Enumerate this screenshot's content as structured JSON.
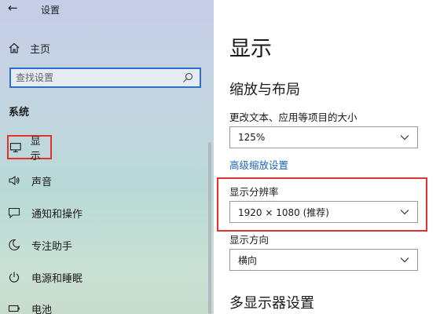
{
  "app": {
    "title": "设置"
  },
  "sidebar": {
    "home_label": "主页",
    "search_placeholder": "查找设置",
    "section_label": "系统",
    "items": [
      {
        "label": "显示",
        "icon": "monitor-icon",
        "active": true
      },
      {
        "label": "声音",
        "icon": "speaker-icon"
      },
      {
        "label": "通知和操作",
        "icon": "notification-icon"
      },
      {
        "label": "专注助手",
        "icon": "moon-icon"
      },
      {
        "label": "电源和睡眠",
        "icon": "power-icon"
      },
      {
        "label": "电池",
        "icon": "battery-icon"
      }
    ]
  },
  "main": {
    "title": "显示",
    "scale_section": {
      "heading": "缩放与布局",
      "text_size_label": "更改文本、应用等项目的大小",
      "text_size_value": "125%",
      "advanced_link": "高级缩放设置",
      "resolution_label": "显示分辨率",
      "resolution_value": "1920 × 1080 (推荐)",
      "orientation_label": "显示方向",
      "orientation_value": "横向"
    },
    "multi_display_heading": "多显示器设置"
  },
  "colors": {
    "accent": "#1a64b8",
    "highlight": "#e0332e",
    "search_border": "#2b6fc7"
  }
}
